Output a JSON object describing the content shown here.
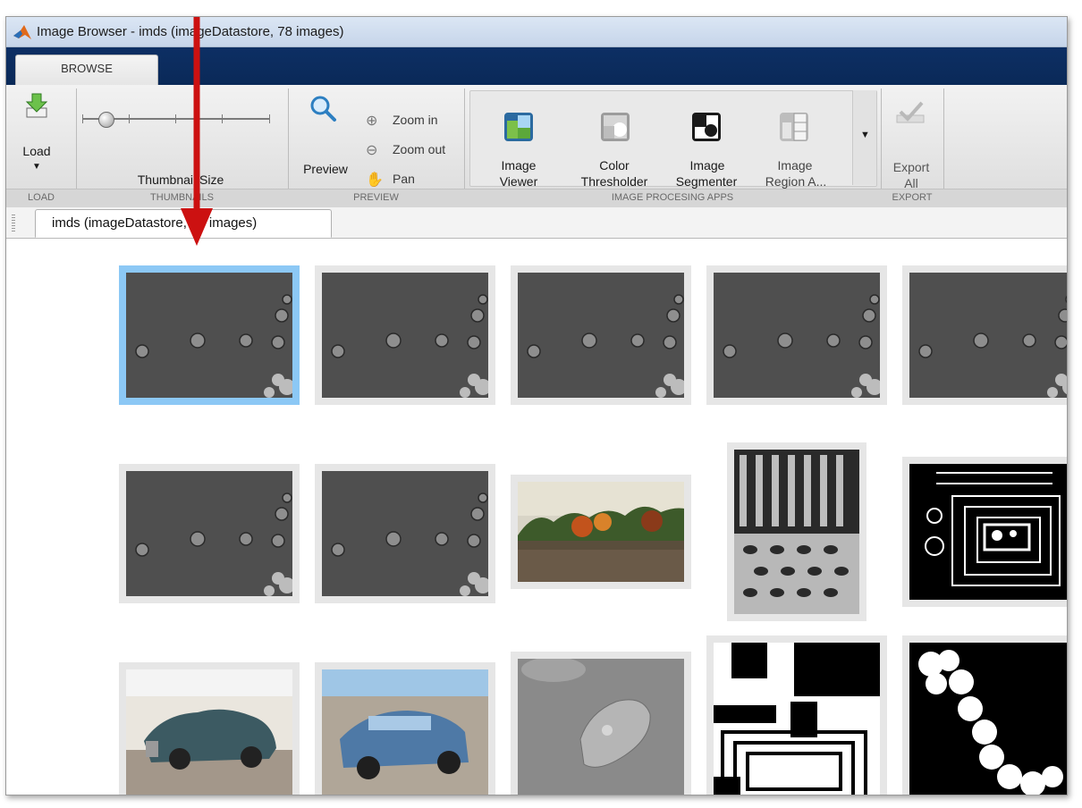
{
  "window": {
    "title": "Image Browser - imds (imageDatastore, 78 images)"
  },
  "ribbon": {
    "tab": "BROWSE",
    "load": {
      "label": "Load"
    },
    "thumbnail_size_label": "Thumbnail Size",
    "preview": {
      "preview_label": "Preview",
      "zoom_in": "Zoom in",
      "zoom_out": "Zoom out",
      "pan": "Pan"
    },
    "apps": [
      {
        "line1": "Image",
        "line2": "Viewer"
      },
      {
        "line1": "Color",
        "line2": "Thresholder"
      },
      {
        "line1": "Image",
        "line2": "Segmenter"
      },
      {
        "line1": "Image",
        "line2": "Region A..."
      }
    ],
    "export": {
      "line1": "Export",
      "line2": "All"
    },
    "sections": {
      "load": "LOAD",
      "thumbnails": "THUMBNAILS",
      "preview": "PREVIEW",
      "apps": "IMAGE PROCESING APPS",
      "export": "EXPORT"
    }
  },
  "document_tab": {
    "label": "imds (imageDatastore, 78 images)"
  },
  "thumbnails": [
    {
      "kind": "cells",
      "selected": true
    },
    {
      "kind": "cells",
      "selected": false
    },
    {
      "kind": "cells",
      "selected": false
    },
    {
      "kind": "cells",
      "selected": false
    },
    {
      "kind": "cells",
      "selected": false
    },
    {
      "kind": "cells",
      "selected": false
    },
    {
      "kind": "cells",
      "selected": false
    },
    {
      "kind": "landscape-lake",
      "selected": false
    },
    {
      "kind": "texture",
      "selected": false
    },
    {
      "kind": "binary-shapes",
      "selected": false
    },
    {
      "kind": "car-photo",
      "selected": false
    },
    {
      "kind": "car-photo",
      "selected": false
    },
    {
      "kind": "cell-closeup",
      "selected": false
    },
    {
      "kind": "binary-text",
      "selected": false
    },
    {
      "kind": "binary-circles",
      "selected": false
    }
  ],
  "colors": {
    "ribbon_blue": "#0d2f64",
    "selection": "#8cc8f5",
    "annotation_arrow": "#cc1111"
  }
}
